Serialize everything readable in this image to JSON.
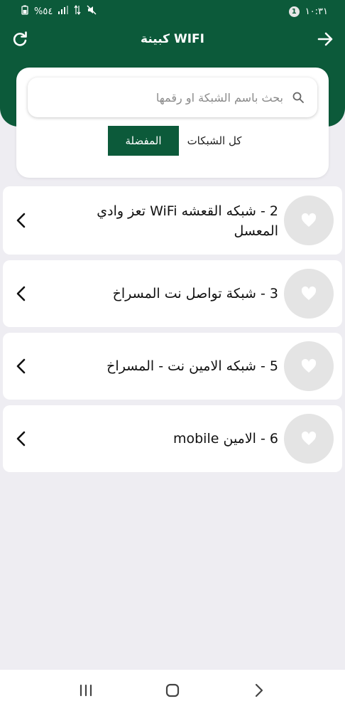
{
  "status_bar": {
    "time": "١٠:٣١",
    "notification_count": "1",
    "battery": "%٥٤"
  },
  "header": {
    "title": "كبينة WIFI"
  },
  "search": {
    "placeholder": "بحث باسم الشبكة او رقمها"
  },
  "tabs": [
    {
      "label": "كل الشبكات",
      "active": false
    },
    {
      "label": "المفضلة",
      "active": true
    }
  ],
  "networks": [
    {
      "title": "2 - شبكه القعشه WiFi تعز وادي المعسل"
    },
    {
      "title": "3 - شبكة تواصل نت المسراخ"
    },
    {
      "title": "5 - شبكه الامين نت - المسراخ"
    },
    {
      "title": "6 - الامين mobile"
    }
  ],
  "colors": {
    "brand_green": "#0c5a3a",
    "background": "#eeedf2",
    "card": "#ffffff",
    "heart_circle": "#e4e4e4"
  }
}
